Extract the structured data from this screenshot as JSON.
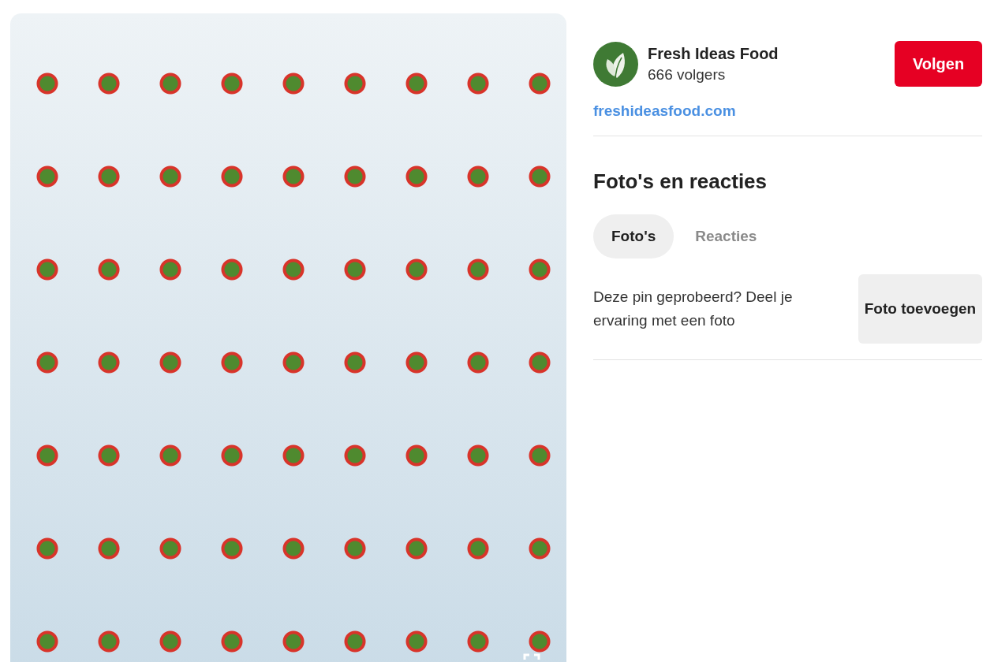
{
  "profile": {
    "name": "Fresh Ideas Food",
    "followers": "666 volgers",
    "follow_button": "Volgen",
    "website": "freshideasfood.com"
  },
  "section": {
    "title": "Foto's en reacties",
    "tabs": [
      {
        "label": "Foto's",
        "selected": true
      },
      {
        "label": "Reacties",
        "selected": false
      }
    ],
    "prompt": "Deze pin geprobeerd? Deel je ervaring met een foto",
    "add_button": "Foto toevoegen"
  }
}
